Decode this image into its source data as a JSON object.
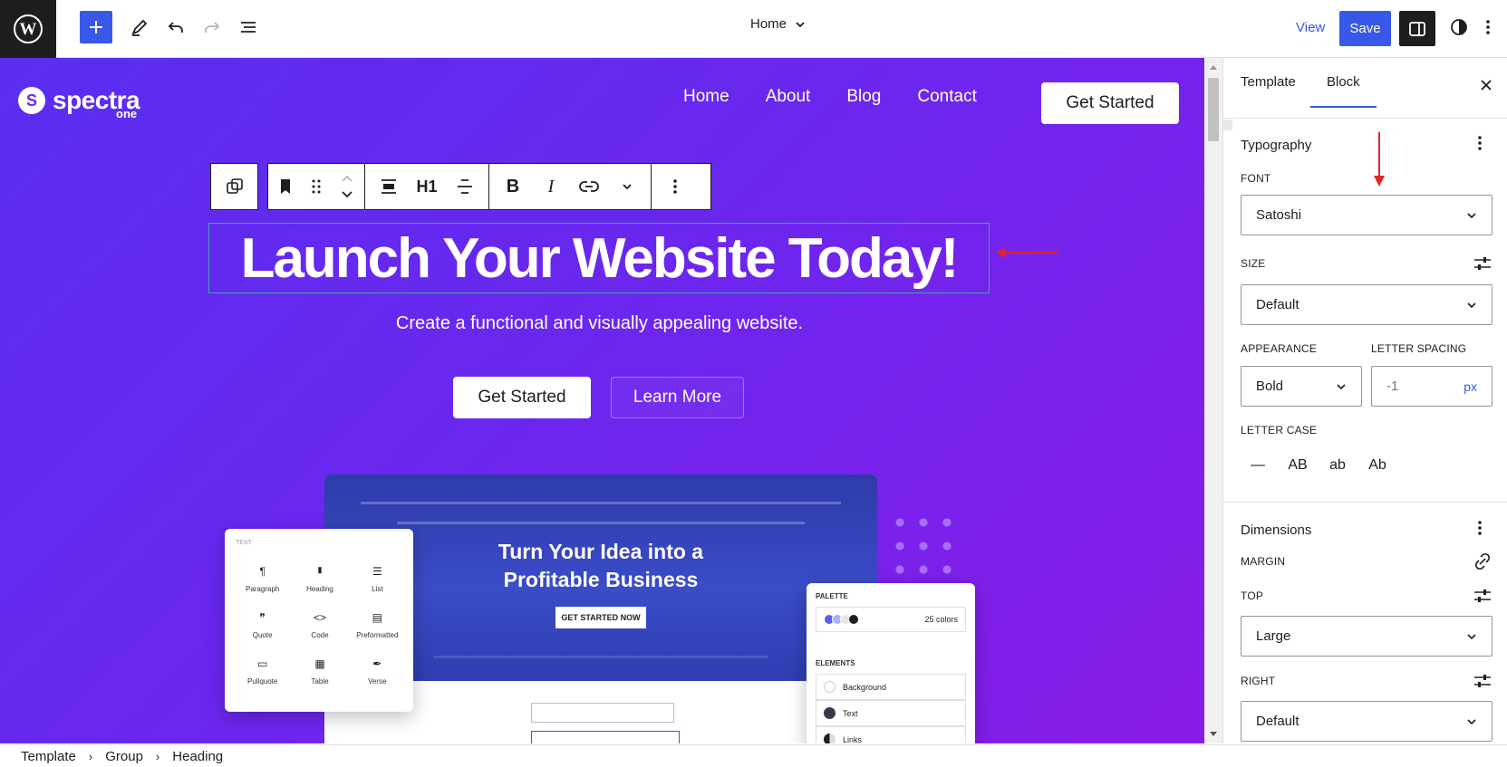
{
  "topbar": {
    "document_title": "Home",
    "view_label": "View",
    "save_label": "Save"
  },
  "site": {
    "logo_text": "spectra",
    "logo_sub": "one",
    "nav": [
      "Home",
      "About",
      "Blog",
      "Contact"
    ],
    "header_cta": "Get Started"
  },
  "block_toolbar": {
    "heading_level": "H1"
  },
  "hero": {
    "heading": "Launch Your Website Today!",
    "subheading": "Create a functional and visually appealing website.",
    "primary_button": "Get Started",
    "secondary_button": "Learn More"
  },
  "mockup": {
    "headline_line1": "Turn Your Idea into a",
    "headline_line2": "Profitable Business",
    "cta": "GET STARTED NOW",
    "text_card": {
      "title": "TEXT",
      "items": [
        {
          "icon": "¶",
          "label": "Paragraph"
        },
        {
          "icon": "🔖",
          "label": "Heading"
        },
        {
          "icon": "☰",
          "label": "List"
        },
        {
          "icon": "❞",
          "label": "Quote"
        },
        {
          "icon": "<>",
          "label": "Code"
        },
        {
          "icon": "▤",
          "label": "Preformatted"
        },
        {
          "icon": "▭",
          "label": "Pullquote"
        },
        {
          "icon": "▦",
          "label": "Table"
        },
        {
          "icon": "✒",
          "label": "Verse"
        }
      ]
    },
    "palette_card": {
      "palette_label": "PALETTE",
      "colors_count": "25 colors",
      "elements_label": "ELEMENTS",
      "elements": [
        "Background",
        "Text",
        "Links"
      ]
    }
  },
  "breadcrumb": [
    "Template",
    "Group",
    "Heading"
  ],
  "sidebar": {
    "tabs": [
      "Template",
      "Block"
    ],
    "active_tab": "Block",
    "typography": {
      "title": "Typography",
      "font_label": "FONT",
      "font_value": "Satoshi",
      "size_label": "SIZE",
      "size_value": "Default",
      "appearance_label": "APPEARANCE",
      "appearance_value": "Bold",
      "letter_spacing_label": "LETTER SPACING",
      "letter_spacing_value": "-1",
      "letter_spacing_unit": "px",
      "letter_case_label": "LETTER CASE",
      "letter_case_options": [
        "—",
        "AB",
        "ab",
        "Ab"
      ]
    },
    "dimensions": {
      "title": "Dimensions",
      "margin_label": "MARGIN",
      "top_label": "TOP",
      "top_value": "Large",
      "right_label": "RIGHT",
      "right_value": "Default"
    }
  },
  "colors": {
    "accent": "#3858e9",
    "canvas_start": "#5a2ef0",
    "canvas_end": "#8a1ce8",
    "annotation": "#e02424"
  }
}
